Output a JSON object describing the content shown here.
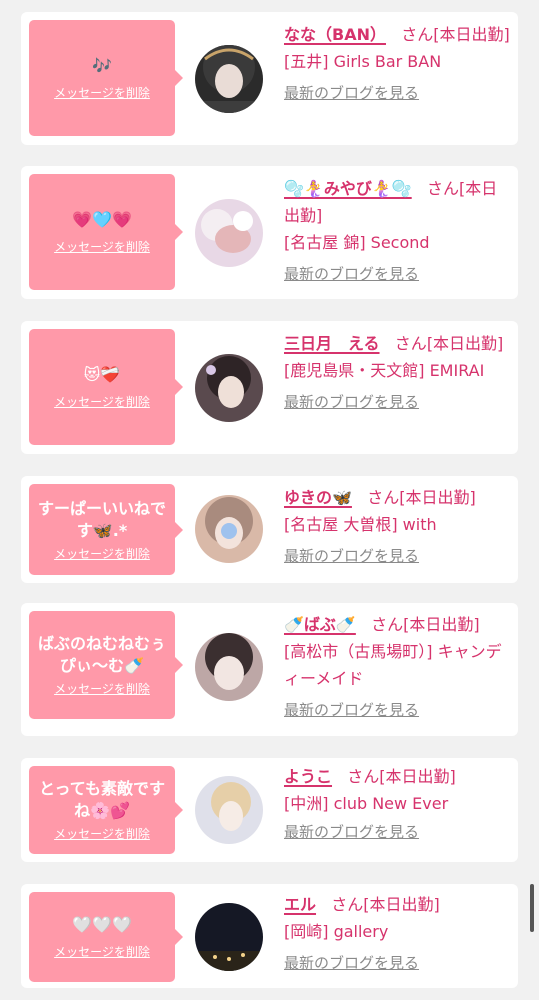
{
  "cards": [
    {
      "message": "🎶",
      "delete_label": "メッセージを削除",
      "name": "なな（BAN）",
      "san": "さん",
      "status": "[本日出勤]",
      "shop": "[五井] Girls Bar BAN",
      "blog_label": "最新のブログを見る",
      "avatar_color": "#2b2b2b"
    },
    {
      "message": "💗🩵💗",
      "delete_label": "メッセージを削除",
      "name": "🫧🧜‍♀️みやび🧜‍♀️🫧",
      "san": "さん",
      "status": "[本日出勤]",
      "shop": "[名古屋 錦] Second",
      "blog_label": "最新のブログを見る",
      "avatar_color": "#e8d8e6"
    },
    {
      "message": "😻❤️‍🩹",
      "delete_label": "メッセージを削除",
      "name": "三日月　える",
      "san": "さん",
      "status": "[本日出勤]",
      "shop": "[鹿児島県・天文館] EMIRAI",
      "blog_label": "最新のブログを見る",
      "avatar_color": "#5a4a4e"
    },
    {
      "message": "すーぱーいいねです🦋.*",
      "delete_label": "メッセージを削除",
      "name": "ゆきの🦋",
      "san": "さん",
      "status": "[本日出勤]",
      "shop": "[名古屋 大曽根] with",
      "blog_label": "最新のブログを見る",
      "avatar_color": "#d9b9a8"
    },
    {
      "message": "ばぶのねむねむぅぴぃ〜む🍼",
      "delete_label": "メッセージを削除",
      "name": "🍼ばぶ🍼",
      "san": "さん",
      "status": "[本日出勤]",
      "shop": "[高松市（古馬場町）] キャンディーメイド",
      "blog_label": "最新のブログを見る",
      "avatar_color": "#bda7a6"
    },
    {
      "message": "とっても素敵ですね🌸💕",
      "delete_label": "メッセージを削除",
      "name": "ようこ",
      "san": "さん",
      "status": "[本日出勤]",
      "shop": "[中洲] club New Ever",
      "blog_label": "",
      "avatar_color": "#dfe0ea"
    },
    {
      "message": "🤍🤍🤍",
      "delete_label": "メッセージを削除",
      "name": "エル",
      "san": "さん",
      "status": "[本日出勤]",
      "shop": "[岡崎] gallery",
      "blog_label": "最新のブログを見る",
      "avatar_color": "#151825"
    }
  ],
  "colors": {
    "accent": "#d6336c",
    "bubble": "#ff99a9",
    "background": "#f1f1f1",
    "link_gray": "#8a8a8a"
  }
}
